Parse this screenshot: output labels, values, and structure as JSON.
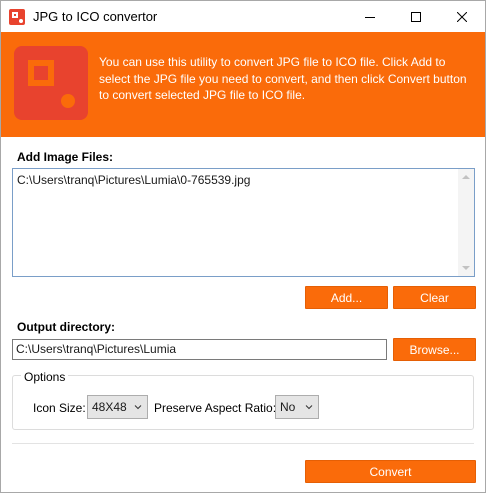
{
  "window": {
    "title": "JPG to ICO convertor"
  },
  "banner": {
    "description": "You can use this utility to convert JPG file to ICO file. Click Add to select the JPG file you need to convert, and then click Convert button to convert selected JPG file to ICO file."
  },
  "add_files": {
    "label": "Add Image Files:",
    "files": [
      "C:\\Users\\tranq\\Pictures\\Lumia\\0-765539.jpg"
    ],
    "add_label": "Add...",
    "clear_label": "Clear"
  },
  "output": {
    "label": "Output directory:",
    "value": "C:\\Users\\tranq\\Pictures\\Lumia",
    "browse_label": "Browse..."
  },
  "options": {
    "legend": "Options",
    "icon_size_label": "Icon Size:",
    "icon_size_value": "48X48",
    "aspect_label": "Preserve Aspect Ratio:",
    "aspect_value": "No"
  },
  "actions": {
    "convert_label": "Convert"
  },
  "colors": {
    "accent": "#fa6b0a",
    "logo": "#e8432e"
  }
}
